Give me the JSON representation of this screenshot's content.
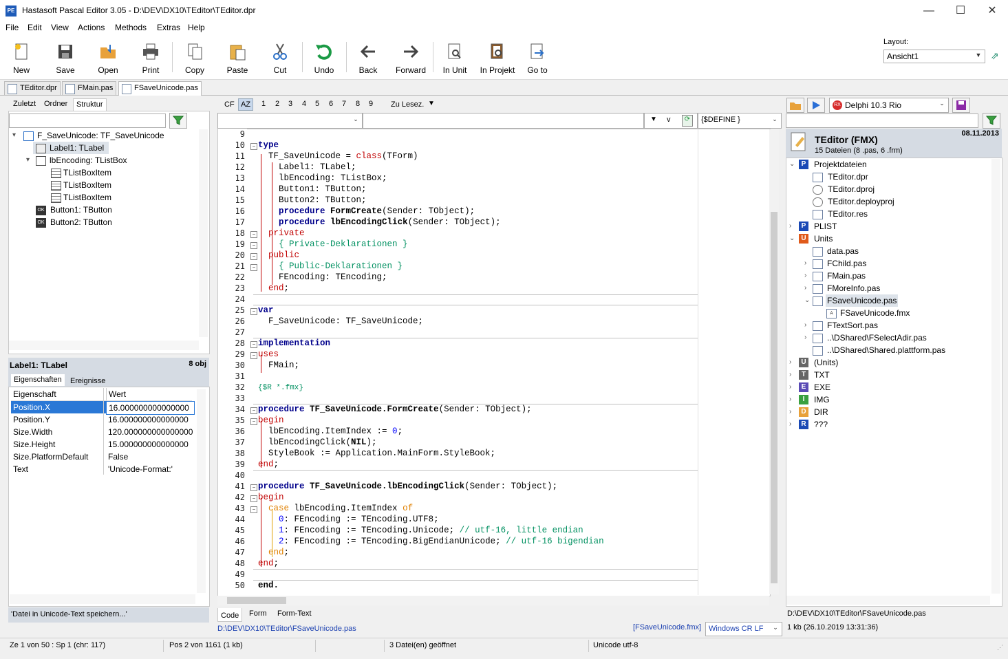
{
  "window": {
    "app_icon": "PE",
    "title": "Hastasoft Pascal Editor 3.05 - D:\\DEV\\DX10\\TEditor\\TEditor.dpr",
    "minimize": "—",
    "maximize": "☐",
    "close": "✕"
  },
  "menu": [
    "File",
    "Edit",
    "View",
    "Actions",
    "Methods",
    "Extras",
    "Help"
  ],
  "toolbar": {
    "buttons": [
      "New",
      "Save",
      "Open",
      "Print",
      "Copy",
      "Paste",
      "Cut",
      "Undo",
      "Back",
      "Forward",
      "In Unit",
      "In Projekt",
      "Go to"
    ],
    "layout_label": "Layout:",
    "layout_value": "Ansicht1"
  },
  "file_tabs": [
    "TEditor.dpr",
    "FMain.pas",
    "FSaveUnicode.pas"
  ],
  "left_panel": {
    "tabs": [
      "Zuletzt",
      "Ordner",
      "Struktur"
    ],
    "search_value": "",
    "tree": [
      "F_SaveUnicode: TF_SaveUnicode",
      "Label1: TLabel",
      "lbEncoding: TListBox",
      "TListBoxItem",
      "TListBoxItem",
      "TListBoxItem",
      "Button1: TButton",
      "Button2: TButton"
    ],
    "object_title": "Label1: TLabel",
    "object_count": "8 obj",
    "prop_tabs": [
      "Eigenschaften",
      "Ereignisse"
    ],
    "prop_headers": [
      "Eigenschaft",
      "Wert"
    ],
    "props": [
      [
        "Position.X",
        "16.000000000000000"
      ],
      [
        "Position.Y",
        "16.000000000000000"
      ],
      [
        "Size.Width",
        "120.000000000000000"
      ],
      [
        "Size.Height",
        "15.000000000000000"
      ],
      [
        "Size.PlatformDefault",
        "False"
      ],
      [
        "Text",
        "'Unicode-Format:'"
      ]
    ],
    "hint": "'Datei in Unicode-Text speichern...'"
  },
  "editor": {
    "toolbar_items": [
      "CF",
      "AZ",
      "1",
      "2",
      "3",
      "4",
      "5",
      "6",
      "7",
      "8",
      "9",
      "Zu Lesez."
    ],
    "define_combo": "{$DEFINE }",
    "line_numbers": [
      "9",
      "10",
      "11",
      "12",
      "13",
      "14",
      "15",
      "16",
      "17",
      "18",
      "19",
      "20",
      "21",
      "22",
      "23",
      "24",
      "25",
      "26",
      "27",
      "28",
      "29",
      "30",
      "31",
      "32",
      "33",
      "34",
      "35",
      "36",
      "37",
      "38",
      "39",
      "40",
      "41",
      "42",
      "43",
      "44",
      "45",
      "46",
      "47",
      "48",
      "49",
      "50"
    ],
    "bottom_tabs": [
      "Code",
      "Form",
      "Form-Text"
    ],
    "file_path": "D:\\DEV\\DX10\\TEditor\\FSaveUnicode.pas",
    "form_file": "[FSaveUnicode.fmx]",
    "line_ending": "Windows CR LF"
  },
  "right_panel": {
    "compiler": "Delphi 10.3 Rio",
    "project_name": "TEditor (FMX)",
    "project_date": "08.11.2013",
    "project_info": "15 Dateien (8 .pas, 6 .frm)",
    "tree": [
      "Projektdateien",
      "TEditor.dpr",
      "TEditor.dproj",
      "TEditor.deployproj",
      "TEditor.res",
      "PLIST",
      "Units",
      "data.pas",
      "FChild.pas",
      "FMain.pas",
      "FMoreInfo.pas",
      "FSaveUnicode.pas",
      "FSaveUnicode.fmx",
      "FTextSort.pas",
      "..\\DShared\\FSelectAdir.pas",
      "..\\DShared\\Shared.plattform.pas",
      "(Units)",
      "TXT",
      "EXE",
      "IMG",
      "DIR",
      "???"
    ],
    "file_path": "D:\\DEV\\DX10\\TEditor\\FSaveUnicode.pas",
    "file_info": "1 kb (26.10.2019 13:31:36)"
  },
  "status": [
    "Ze 1 von 50 : Sp 1  (chr: 117)",
    "Pos 2 von 1161 (1 kb)",
    "3 Datei(en) geöffnet",
    "Unicode utf-8"
  ]
}
